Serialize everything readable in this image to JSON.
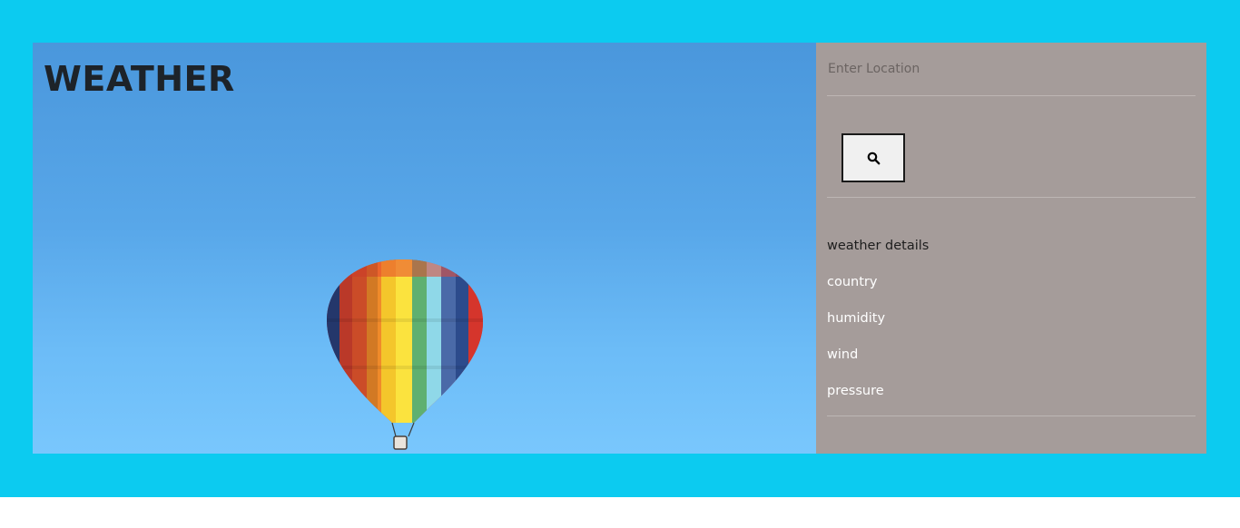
{
  "app": {
    "title": "WEATHER"
  },
  "search": {
    "placeholder": "Enter Location",
    "value": "",
    "button_icon": "search-icon"
  },
  "details": {
    "heading": "weather details",
    "items": [
      "country",
      "humidity",
      "wind",
      "pressure"
    ]
  },
  "colors": {
    "page_background": "#0ccbf0",
    "panel_background": "#a59c9a",
    "sky_top": "#4a97dc",
    "sky_bottom": "#79c7fd"
  }
}
